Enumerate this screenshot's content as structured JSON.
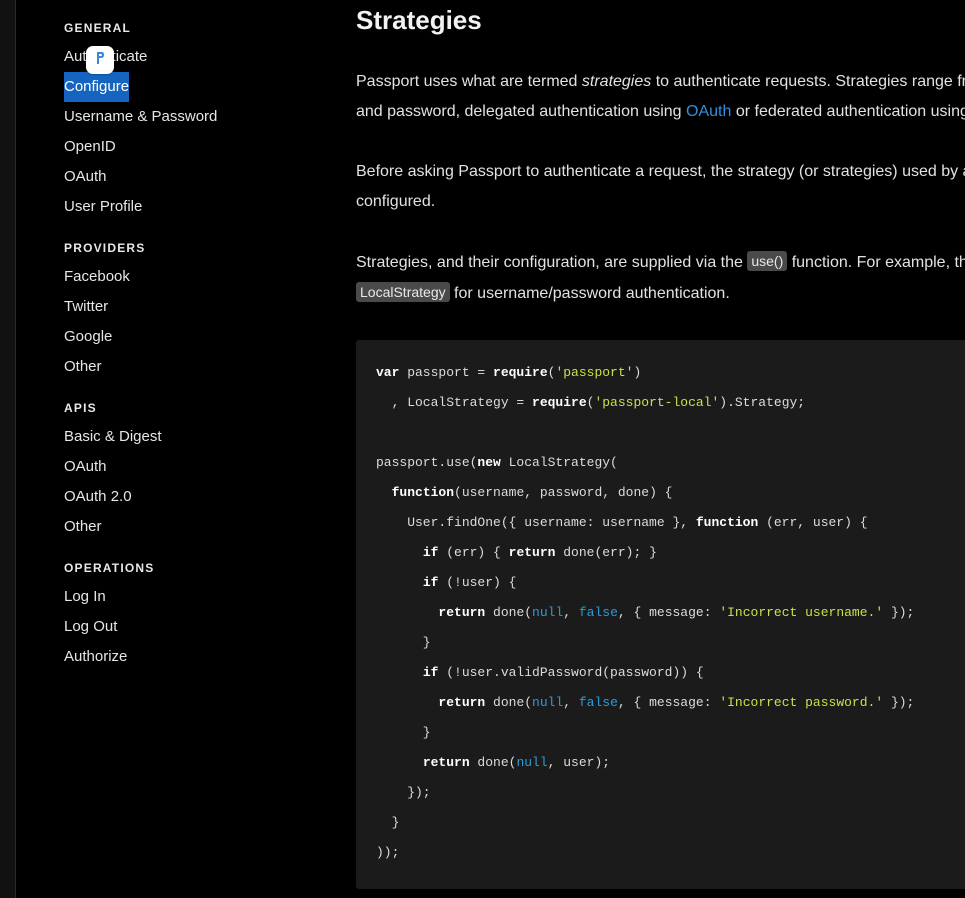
{
  "sidebar": {
    "sections": [
      {
        "heading": "GENERAL",
        "items": [
          "Authenticate",
          "Configure",
          "Username & Password",
          "OpenID",
          "OAuth",
          "User Profile"
        ]
      },
      {
        "heading": "PROVIDERS",
        "items": [
          "Facebook",
          "Twitter",
          "Google",
          "Other"
        ]
      },
      {
        "heading": "APIS",
        "items": [
          "Basic & Digest",
          "OAuth",
          "OAuth 2.0",
          "Other"
        ]
      },
      {
        "heading": "OPERATIONS",
        "items": [
          "Log In",
          "Log Out",
          "Authorize"
        ]
      }
    ],
    "active_item": "Configure"
  },
  "content": {
    "title": "Strategies",
    "p1": {
      "line1_before": "Passport uses what are termed ",
      "line1_em": "strategies",
      "line1_after": " to authenticate requests. Strategies range fr",
      "line2_before": "and password, delegated authentication using ",
      "line2_link": "OAuth",
      "line2_after": " or federated authentication using"
    },
    "p2": {
      "line1": "Before asking Passport to authenticate a request, the strategy (or strategies) used by a",
      "line2": "configured."
    },
    "p3": {
      "line1_before": "Strategies, and their configuration, are supplied via the ",
      "line1_code": "use()",
      "line1_after": " function. For example, th",
      "line2_code": "LocalStrategy",
      "line2_after": " for username/password authentication."
    },
    "code": {
      "l1_kw": "var",
      "l1_a": " passport = ",
      "l1_kw2": "require",
      "l1_b": "(",
      "l1_str": "'passport'",
      "l1_c": ")",
      "l2_a": "  , LocalStrategy = ",
      "l2_kw": "require",
      "l2_b": "(",
      "l2_str": "'passport-local'",
      "l2_c": ").Strategy;",
      "l3_a": "passport.use(",
      "l3_kw": "new",
      "l3_b": " LocalStrategy(",
      "l4_a": "  ",
      "l4_kw": "function",
      "l4_b": "(username, password, done) {",
      "l5_a": "    User.findOne({ username: username }, ",
      "l5_kw": "function",
      "l5_b": " (err, user) {",
      "l6_a": "      ",
      "l6_kw": "if",
      "l6_b": " (err) { ",
      "l6_kw2": "return",
      "l6_c": " done(err); }",
      "l7_a": "      ",
      "l7_kw": "if",
      "l7_b": " (!user) {",
      "l8_a": "        ",
      "l8_kw": "return",
      "l8_b": " done(",
      "l8_lit1": "null",
      "l8_c": ", ",
      "l8_lit2": "false",
      "l8_d": ", { message: ",
      "l8_str": "'Incorrect username.'",
      "l8_e": " });",
      "l9": "      }",
      "l10_a": "      ",
      "l10_kw": "if",
      "l10_b": " (!user.validPassword(password)) {",
      "l11_a": "        ",
      "l11_kw": "return",
      "l11_b": " done(",
      "l11_lit1": "null",
      "l11_c": ", ",
      "l11_lit2": "false",
      "l11_d": ", { message: ",
      "l11_str": "'Incorrect password.'",
      "l11_e": " });",
      "l12": "      }",
      "l13_a": "      ",
      "l13_kw": "return",
      "l13_b": " done(",
      "l13_lit": "null",
      "l13_c": ", user);",
      "l14": "    });",
      "l15": "  }",
      "l16": "));"
    }
  }
}
